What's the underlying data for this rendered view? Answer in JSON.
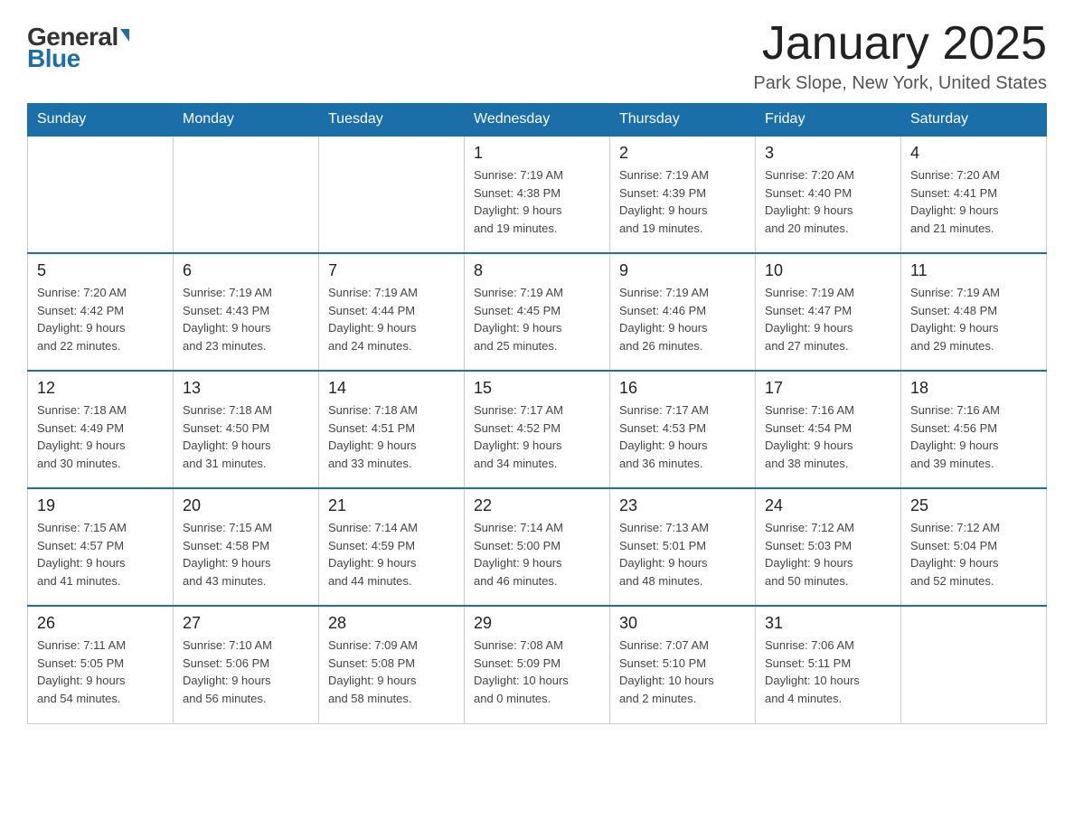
{
  "header": {
    "logo_general": "General",
    "logo_blue": "Blue",
    "month_title": "January 2025",
    "location": "Park Slope, New York, United States"
  },
  "weekdays": [
    "Sunday",
    "Monday",
    "Tuesday",
    "Wednesday",
    "Thursday",
    "Friday",
    "Saturday"
  ],
  "weeks": [
    [
      {
        "day": "",
        "info": ""
      },
      {
        "day": "",
        "info": ""
      },
      {
        "day": "",
        "info": ""
      },
      {
        "day": "1",
        "info": "Sunrise: 7:19 AM\nSunset: 4:38 PM\nDaylight: 9 hours\nand 19 minutes."
      },
      {
        "day": "2",
        "info": "Sunrise: 7:19 AM\nSunset: 4:39 PM\nDaylight: 9 hours\nand 19 minutes."
      },
      {
        "day": "3",
        "info": "Sunrise: 7:20 AM\nSunset: 4:40 PM\nDaylight: 9 hours\nand 20 minutes."
      },
      {
        "day": "4",
        "info": "Sunrise: 7:20 AM\nSunset: 4:41 PM\nDaylight: 9 hours\nand 21 minutes."
      }
    ],
    [
      {
        "day": "5",
        "info": "Sunrise: 7:20 AM\nSunset: 4:42 PM\nDaylight: 9 hours\nand 22 minutes."
      },
      {
        "day": "6",
        "info": "Sunrise: 7:19 AM\nSunset: 4:43 PM\nDaylight: 9 hours\nand 23 minutes."
      },
      {
        "day": "7",
        "info": "Sunrise: 7:19 AM\nSunset: 4:44 PM\nDaylight: 9 hours\nand 24 minutes."
      },
      {
        "day": "8",
        "info": "Sunrise: 7:19 AM\nSunset: 4:45 PM\nDaylight: 9 hours\nand 25 minutes."
      },
      {
        "day": "9",
        "info": "Sunrise: 7:19 AM\nSunset: 4:46 PM\nDaylight: 9 hours\nand 26 minutes."
      },
      {
        "day": "10",
        "info": "Sunrise: 7:19 AM\nSunset: 4:47 PM\nDaylight: 9 hours\nand 27 minutes."
      },
      {
        "day": "11",
        "info": "Sunrise: 7:19 AM\nSunset: 4:48 PM\nDaylight: 9 hours\nand 29 minutes."
      }
    ],
    [
      {
        "day": "12",
        "info": "Sunrise: 7:18 AM\nSunset: 4:49 PM\nDaylight: 9 hours\nand 30 minutes."
      },
      {
        "day": "13",
        "info": "Sunrise: 7:18 AM\nSunset: 4:50 PM\nDaylight: 9 hours\nand 31 minutes."
      },
      {
        "day": "14",
        "info": "Sunrise: 7:18 AM\nSunset: 4:51 PM\nDaylight: 9 hours\nand 33 minutes."
      },
      {
        "day": "15",
        "info": "Sunrise: 7:17 AM\nSunset: 4:52 PM\nDaylight: 9 hours\nand 34 minutes."
      },
      {
        "day": "16",
        "info": "Sunrise: 7:17 AM\nSunset: 4:53 PM\nDaylight: 9 hours\nand 36 minutes."
      },
      {
        "day": "17",
        "info": "Sunrise: 7:16 AM\nSunset: 4:54 PM\nDaylight: 9 hours\nand 38 minutes."
      },
      {
        "day": "18",
        "info": "Sunrise: 7:16 AM\nSunset: 4:56 PM\nDaylight: 9 hours\nand 39 minutes."
      }
    ],
    [
      {
        "day": "19",
        "info": "Sunrise: 7:15 AM\nSunset: 4:57 PM\nDaylight: 9 hours\nand 41 minutes."
      },
      {
        "day": "20",
        "info": "Sunrise: 7:15 AM\nSunset: 4:58 PM\nDaylight: 9 hours\nand 43 minutes."
      },
      {
        "day": "21",
        "info": "Sunrise: 7:14 AM\nSunset: 4:59 PM\nDaylight: 9 hours\nand 44 minutes."
      },
      {
        "day": "22",
        "info": "Sunrise: 7:14 AM\nSunset: 5:00 PM\nDaylight: 9 hours\nand 46 minutes."
      },
      {
        "day": "23",
        "info": "Sunrise: 7:13 AM\nSunset: 5:01 PM\nDaylight: 9 hours\nand 48 minutes."
      },
      {
        "day": "24",
        "info": "Sunrise: 7:12 AM\nSunset: 5:03 PM\nDaylight: 9 hours\nand 50 minutes."
      },
      {
        "day": "25",
        "info": "Sunrise: 7:12 AM\nSunset: 5:04 PM\nDaylight: 9 hours\nand 52 minutes."
      }
    ],
    [
      {
        "day": "26",
        "info": "Sunrise: 7:11 AM\nSunset: 5:05 PM\nDaylight: 9 hours\nand 54 minutes."
      },
      {
        "day": "27",
        "info": "Sunrise: 7:10 AM\nSunset: 5:06 PM\nDaylight: 9 hours\nand 56 minutes."
      },
      {
        "day": "28",
        "info": "Sunrise: 7:09 AM\nSunset: 5:08 PM\nDaylight: 9 hours\nand 58 minutes."
      },
      {
        "day": "29",
        "info": "Sunrise: 7:08 AM\nSunset: 5:09 PM\nDaylight: 10 hours\nand 0 minutes."
      },
      {
        "day": "30",
        "info": "Sunrise: 7:07 AM\nSunset: 5:10 PM\nDaylight: 10 hours\nand 2 minutes."
      },
      {
        "day": "31",
        "info": "Sunrise: 7:06 AM\nSunset: 5:11 PM\nDaylight: 10 hours\nand 4 minutes."
      },
      {
        "day": "",
        "info": ""
      }
    ]
  ]
}
